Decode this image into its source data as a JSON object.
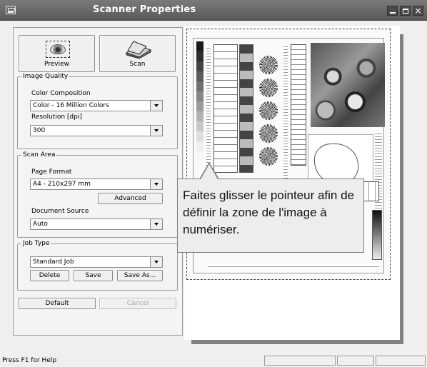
{
  "window": {
    "title": "Scanner Properties",
    "controls": {
      "minimize_icon": "minimize-icon",
      "maximize_icon": "maximize-icon",
      "close_icon": "close-icon"
    }
  },
  "toolbar": {
    "preview_label": "Preview",
    "scan_label": "Scan"
  },
  "image_quality": {
    "title": "Image Quality",
    "color_composition_label": "Color Composition",
    "color_composition_value": "Color - 16 Million Colors",
    "resolution_label": "Resolution [dpi]",
    "resolution_value": "300"
  },
  "scan_area": {
    "title": "Scan Area",
    "page_format_label": "Page Format",
    "page_format_value": "A4 - 210x297 mm",
    "advanced_label": "Advanced",
    "document_source_label": "Document Source",
    "document_source_value": "Auto"
  },
  "job_type": {
    "title": "Job Type",
    "value": "Standard Job",
    "delete_label": "Delete",
    "save_label": "Save",
    "save_as_label": "Save As..."
  },
  "footer_buttons": {
    "default_label": "Default",
    "cancel_label": "Cancel"
  },
  "tooltip": {
    "text": "Faites glisser le pointeur afin de définir la zone de l'image à numériser."
  },
  "statusbar": {
    "help_text": "Press F1 for Help"
  }
}
